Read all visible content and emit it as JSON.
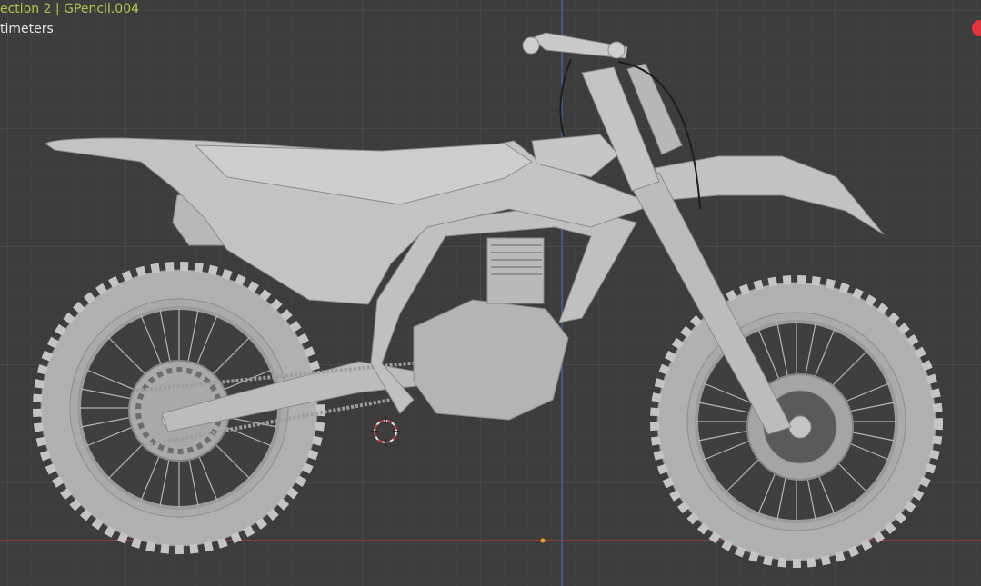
{
  "viewport": {
    "collection_label": "ection 2 | GPencil.004",
    "unit_label": "timeters",
    "background_color": "#3d3d3d",
    "grid_color": "#4b4b4b",
    "x_axis_color": "#b3424a",
    "z_axis_color": "#3f6fb5",
    "model_color": "#bdbdbd",
    "indicator_color": "#e2353f"
  }
}
